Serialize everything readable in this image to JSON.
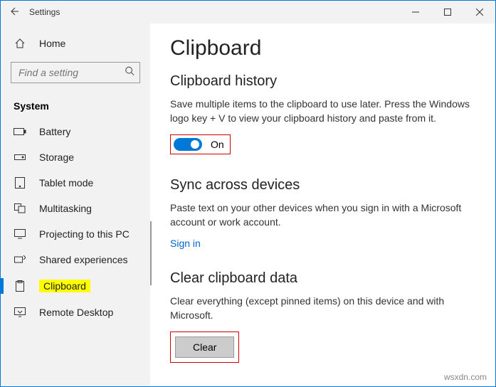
{
  "window": {
    "title": "Settings"
  },
  "sidebar": {
    "home": "Home",
    "search_placeholder": "Find a setting",
    "section": "System",
    "items": [
      {
        "label": "Battery"
      },
      {
        "label": "Storage"
      },
      {
        "label": "Tablet mode"
      },
      {
        "label": "Multitasking"
      },
      {
        "label": "Projecting to this PC"
      },
      {
        "label": "Shared experiences"
      },
      {
        "label": "Clipboard"
      },
      {
        "label": "Remote Desktop"
      }
    ]
  },
  "page": {
    "title": "Clipboard",
    "history": {
      "heading": "Clipboard history",
      "desc": "Save multiple items to the clipboard to use later. Press the Windows logo key + V to view your clipboard history and paste from it.",
      "toggle_state": "On"
    },
    "sync": {
      "heading": "Sync across devices",
      "desc": "Paste text on your other devices when you sign in with a Microsoft account or work account.",
      "signin": "Sign in"
    },
    "clear": {
      "heading": "Clear clipboard data",
      "desc": "Clear everything (except pinned items) on this device and with Microsoft.",
      "button": "Clear"
    }
  },
  "watermark": "wsxdn.com"
}
